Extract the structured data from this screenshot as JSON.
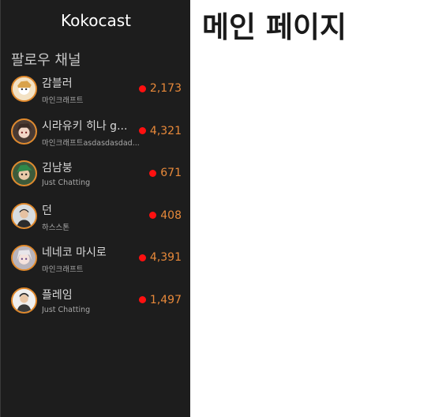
{
  "app": {
    "brand": "Kokocast"
  },
  "sidebar": {
    "section_title": "팔로우 채널",
    "channels": [
      {
        "name": "감블러",
        "category": "마인크래프트",
        "viewers": "2,173",
        "icon": "avatar-gambler"
      },
      {
        "name": "시라유키 히나 g...",
        "category": "마인크래프트asdasdasdad...",
        "viewers": "4,321",
        "icon": "avatar-shirayuki"
      },
      {
        "name": "김남붕",
        "category": "Just Chatting",
        "viewers": "671",
        "icon": "avatar-kimnambung"
      },
      {
        "name": "던",
        "category": "하스스톤",
        "viewers": "408",
        "icon": "avatar-dun"
      },
      {
        "name": "네네코 마시로",
        "category": "마인크래프트",
        "viewers": "4,391",
        "icon": "avatar-neneko"
      },
      {
        "name": "플레임",
        "category": "Just Chatting",
        "viewers": "1,497",
        "icon": "avatar-flame"
      }
    ]
  },
  "main": {
    "title": "메인 페이지"
  },
  "colors": {
    "sidebar_bg": "#1d1d1d",
    "avatar_ring": "#e0892c",
    "viewer_text": "#e8893a",
    "live_dot": "#ff1010"
  }
}
